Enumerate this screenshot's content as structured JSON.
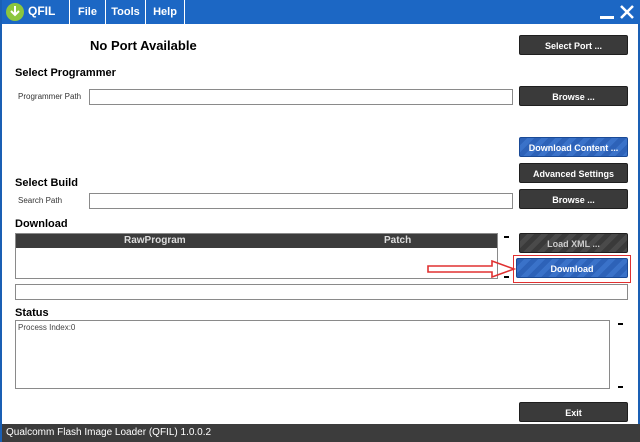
{
  "window": {
    "app_name": "QFIL",
    "menus": [
      "File",
      "Tools",
      "Help"
    ]
  },
  "port": {
    "status": "No Port Available",
    "select_port_label": "Select Port ..."
  },
  "programmer": {
    "section_label": "Select Programmer",
    "path_label": "Programmer Path",
    "path_value": "",
    "browse_label": "Browse ..."
  },
  "download_content_label": "Download Content ...",
  "advanced_settings_label": "Advanced Settings",
  "build": {
    "section_label": "Select Build",
    "path_label": "Search Path",
    "path_value": "",
    "browse_label": "Browse ..."
  },
  "download": {
    "section_label": "Download",
    "columns": [
      "RawProgram",
      "Patch"
    ],
    "load_xml_label": "Load XML ...",
    "download_label": "Download"
  },
  "status": {
    "section_label": "Status",
    "text": "Process Index:0"
  },
  "exit_label": "Exit",
  "footer": {
    "text": "Qualcomm Flash Image Loader (QFIL)   1.0.0.2"
  },
  "colors": {
    "titlebar": "#1c67c4",
    "button_dark": "#3a3a3a",
    "button_blue": "#2d62b8",
    "highlight": "#e03030"
  }
}
